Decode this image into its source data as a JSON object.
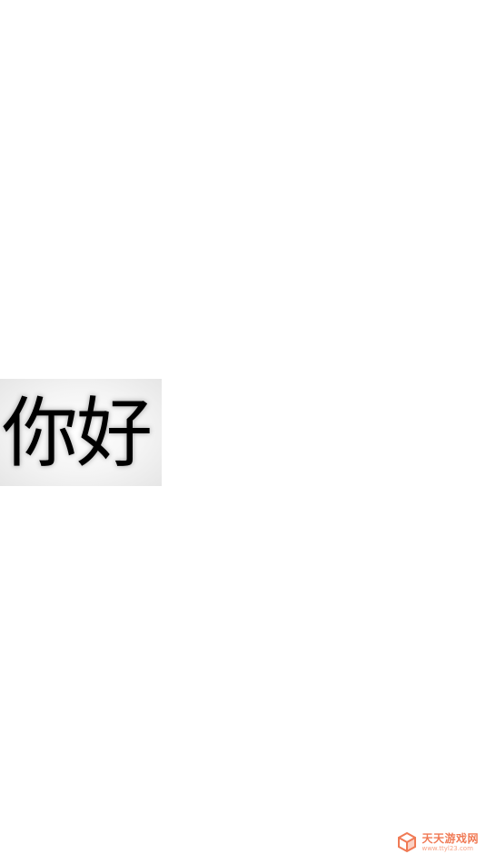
{
  "canvas": {
    "background": "#ffffff"
  },
  "greeting": {
    "text": "你好",
    "color": "#000000"
  },
  "watermark": {
    "title": "天天游戏网",
    "url": "www.ttyl23.com",
    "color": "#f07a55",
    "icon": "cube-logo-icon"
  }
}
